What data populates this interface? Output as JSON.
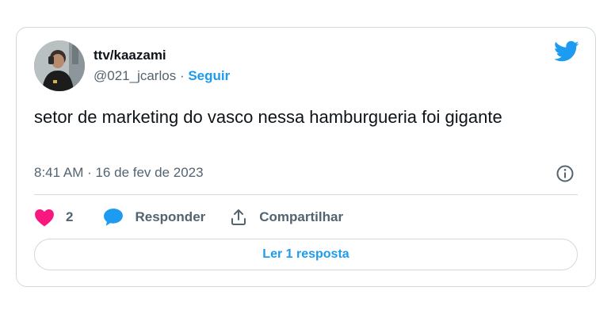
{
  "user": {
    "display_name": "ttv/kaazami",
    "handle": "@021_jcarlos",
    "separator": "·",
    "follow_label": "Seguir",
    "avatar_icon": "user-photo"
  },
  "tweet": {
    "text": "setor de marketing do vasco nessa hamburgueria foi gigante",
    "timestamp": "8:41 AM · 16 de fev de 2023"
  },
  "actions": {
    "likes_count": "2",
    "reply_label": "Responder",
    "share_label": "Compartilhar"
  },
  "read_replies_label": "Ler 1 resposta",
  "icons": {
    "brand": "twitter-bird-icon",
    "info": "info-icon",
    "like": "heart-icon",
    "reply": "speech-bubble-icon",
    "share": "share-icon"
  },
  "colors": {
    "accent": "#1d9bf0",
    "like": "#f91880",
    "text_primary": "#0f1419",
    "text_secondary": "#536471",
    "border": "#cfd9de"
  }
}
